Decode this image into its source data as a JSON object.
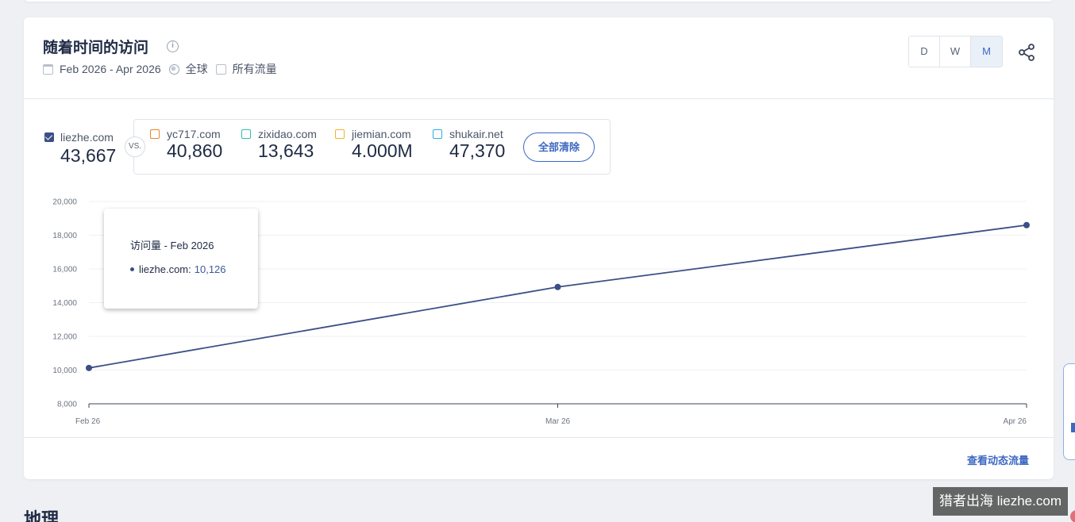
{
  "card": {
    "title": "随着时间的访问",
    "date_range": "Feb 2026 - Apr 2026",
    "region": "全球",
    "traffic": "所有流量",
    "periods": [
      "D",
      "W",
      "M"
    ],
    "active_period": "M"
  },
  "primary": {
    "label": "liezhe.com",
    "value": "43,667",
    "color": "#3b4f85"
  },
  "vs_label": "VS.",
  "competitors": [
    {
      "label": "yc717.com",
      "value": "40,860",
      "color": "#e6862e"
    },
    {
      "label": "zixidao.com",
      "value": "13,643",
      "color": "#2ebfae"
    },
    {
      "label": "jiemian.com",
      "value": "4.000M",
      "color": "#f0b429"
    },
    {
      "label": "shukair.net",
      "value": "47,370",
      "color": "#2eaee6"
    }
  ],
  "clear_all_label": "全部清除",
  "chart_data": {
    "type": "line",
    "x": [
      "Feb 26",
      "Mar 26",
      "Apr 26"
    ],
    "series": [
      {
        "name": "liezhe.com",
        "values": [
          10126,
          14930,
          18600
        ]
      }
    ],
    "ylim": [
      8000,
      20000
    ],
    "yticks": [
      "20,000",
      "18,000",
      "16,000",
      "14,000",
      "12,000",
      "10,000",
      "8,000"
    ],
    "grid": true
  },
  "tooltip": {
    "title": "访问量 - Feb 2026",
    "site": "liezhe.com:",
    "value": "10,126"
  },
  "footer_link": "查看动态流量",
  "geo_heading": "地理",
  "watermark": "猎者出海 liezhe.com"
}
